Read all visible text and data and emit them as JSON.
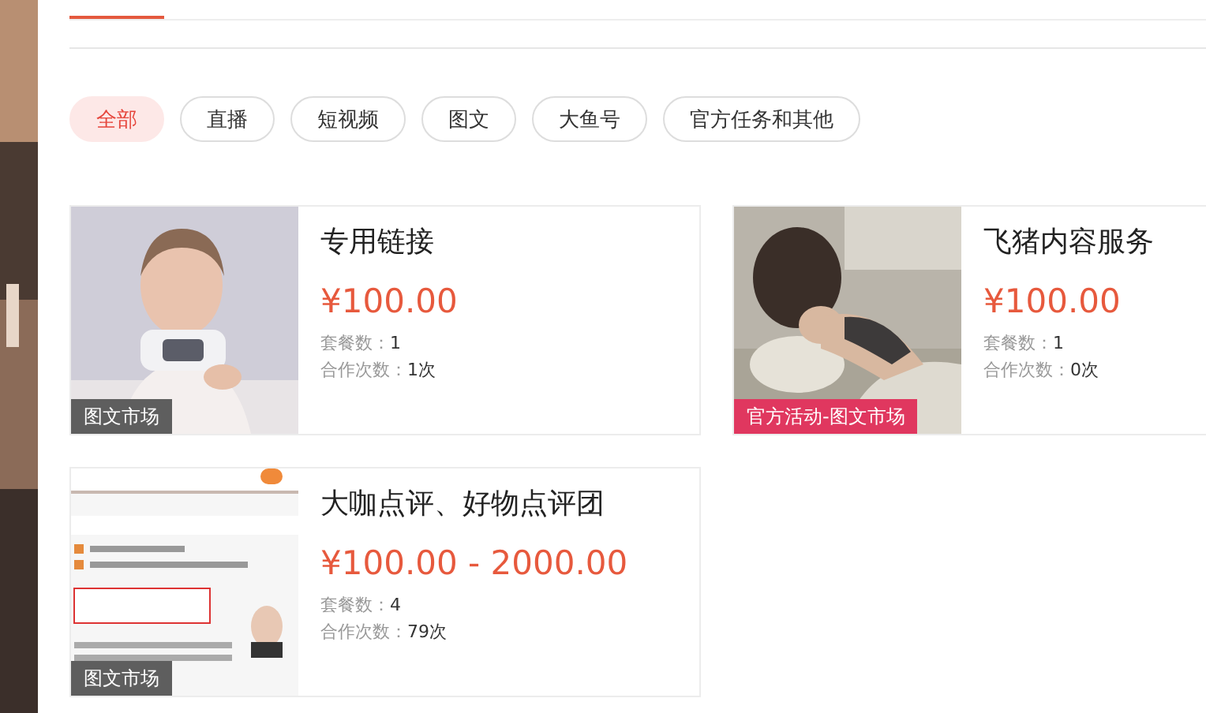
{
  "filters": [
    {
      "label": "全部",
      "selected": true
    },
    {
      "label": "直播",
      "selected": false
    },
    {
      "label": "短视频",
      "selected": false
    },
    {
      "label": "图文",
      "selected": false
    },
    {
      "label": "大鱼号",
      "selected": false
    },
    {
      "label": "官方任务和其他",
      "selected": false
    }
  ],
  "cards": [
    {
      "title": "专用链接",
      "price": "¥100.00",
      "badge": "图文市场",
      "color": "#5e5e5e",
      "package_label": "套餐数：",
      "package_count": "1",
      "coop_label": "合作次数：",
      "coop_count": "1次"
    },
    {
      "title": "飞猪内容服务",
      "price": "¥100.00",
      "badge": "官方活动-图文市场",
      "color": "#e0375f",
      "package_label": "套餐数：",
      "package_count": "1",
      "coop_label": "合作次数：",
      "coop_count": "0次"
    },
    {
      "title": "大咖点评、好物点评团",
      "price": "¥100.00 - 2000.00",
      "badge": "图文市场",
      "color": "#5e5e5e",
      "package_label": "套餐数：",
      "package_count": "4",
      "coop_label": "合作次数：",
      "coop_count": "79次"
    }
  ]
}
